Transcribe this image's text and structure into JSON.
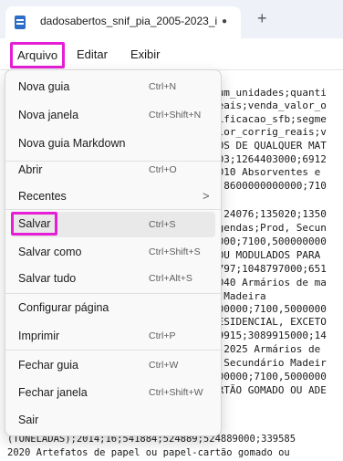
{
  "tab": {
    "title": "dadosabertos_snif_pia_2005-2023_i",
    "modified_indicator": "●",
    "new_tab": "+"
  },
  "menubar": {
    "arquivo": "Arquivo",
    "editar": "Editar",
    "exibir": "Exibir"
  },
  "file_menu": {
    "items": [
      {
        "label": "Nova guia",
        "shortcut": "Ctrl+N"
      },
      {
        "label": "Nova janela",
        "shortcut": "Ctrl+Shift+N"
      },
      {
        "label": "Nova guia Markdown",
        "shortcut": ""
      },
      {
        "label": "Abrir",
        "shortcut": "Ctrl+O"
      },
      {
        "label": "Recentes",
        "shortcut": "",
        "submenu_arrow": ">"
      },
      {
        "label": "Salvar",
        "shortcut": "Ctrl+S"
      },
      {
        "label": "Salvar como",
        "shortcut": "Ctrl+Shift+S"
      },
      {
        "label": "Salvar tudo",
        "shortcut": "Ctrl+Alt+S"
      },
      {
        "label": "Configurar página",
        "shortcut": ""
      },
      {
        "label": "Imprimir",
        "shortcut": "Ctrl+P"
      },
      {
        "label": "Fechar guia",
        "shortcut": "Ctrl+W"
      },
      {
        "label": "Fechar janela",
        "shortcut": "Ctrl+Shift+W"
      },
      {
        "label": "Sair",
        "shortcut": ""
      }
    ]
  },
  "editor": {
    "lines": [
      "num_unidades;quanti",
      "reais;venda_valor_o",
      "sificacao_sfb;segme",
      "alor_corrig_reais;v",
      "COS DE QUALQUER MAT",
      "403;1264403000;6912",
      "2010 Absorventes e",
      "9,8600000000000;710",
      "",
      "4;24076;135020;1350",
      "Agendas;Prod, Secun",
      "0000;7100,500000000",
      " OU MODULADOS PARA",
      "8797;1048797000;651",
      "2040 Armários de ma",
      "o Madeira",
      "000000;7100,5000000",
      "RESIDENCIAL, EXCETO",
      "89915;3089915000;14",
      "1,2025 Armários de",
      ", Secundário Madeir",
      "000000;7100,5000000",
      "ARTÃO GOMADO OU ADE",
      "(TONELADAS);2014;16;541884;524889;524889000;339585",
      "2020 Artefatos de papel ou papel-cartão gomado ou"
    ]
  }
}
